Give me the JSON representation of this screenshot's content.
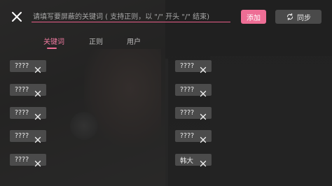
{
  "header": {
    "search_placeholder": "请填写要屏蔽的关键词 ( 支持正则，以 \"/\" 开头 \"/\" 结束)",
    "add_label": "添加",
    "sync_label": "同步"
  },
  "tabs": [
    {
      "label": "关键词",
      "active": true
    },
    {
      "label": "正则",
      "active": false
    },
    {
      "label": "用户",
      "active": false
    }
  ],
  "keywords": {
    "left": [
      "????",
      "????",
      "????",
      "????",
      "????"
    ],
    "right": [
      "????",
      "????",
      "????",
      "????",
      "韩大"
    ]
  },
  "colors": {
    "accent": "#ee6e95",
    "chip_bg": "#4b4b4b",
    "button_gray": "#4a4a4a"
  },
  "icons": {
    "close": "close-icon",
    "sync": "sync-icon",
    "chip_remove": "remove-icon"
  }
}
